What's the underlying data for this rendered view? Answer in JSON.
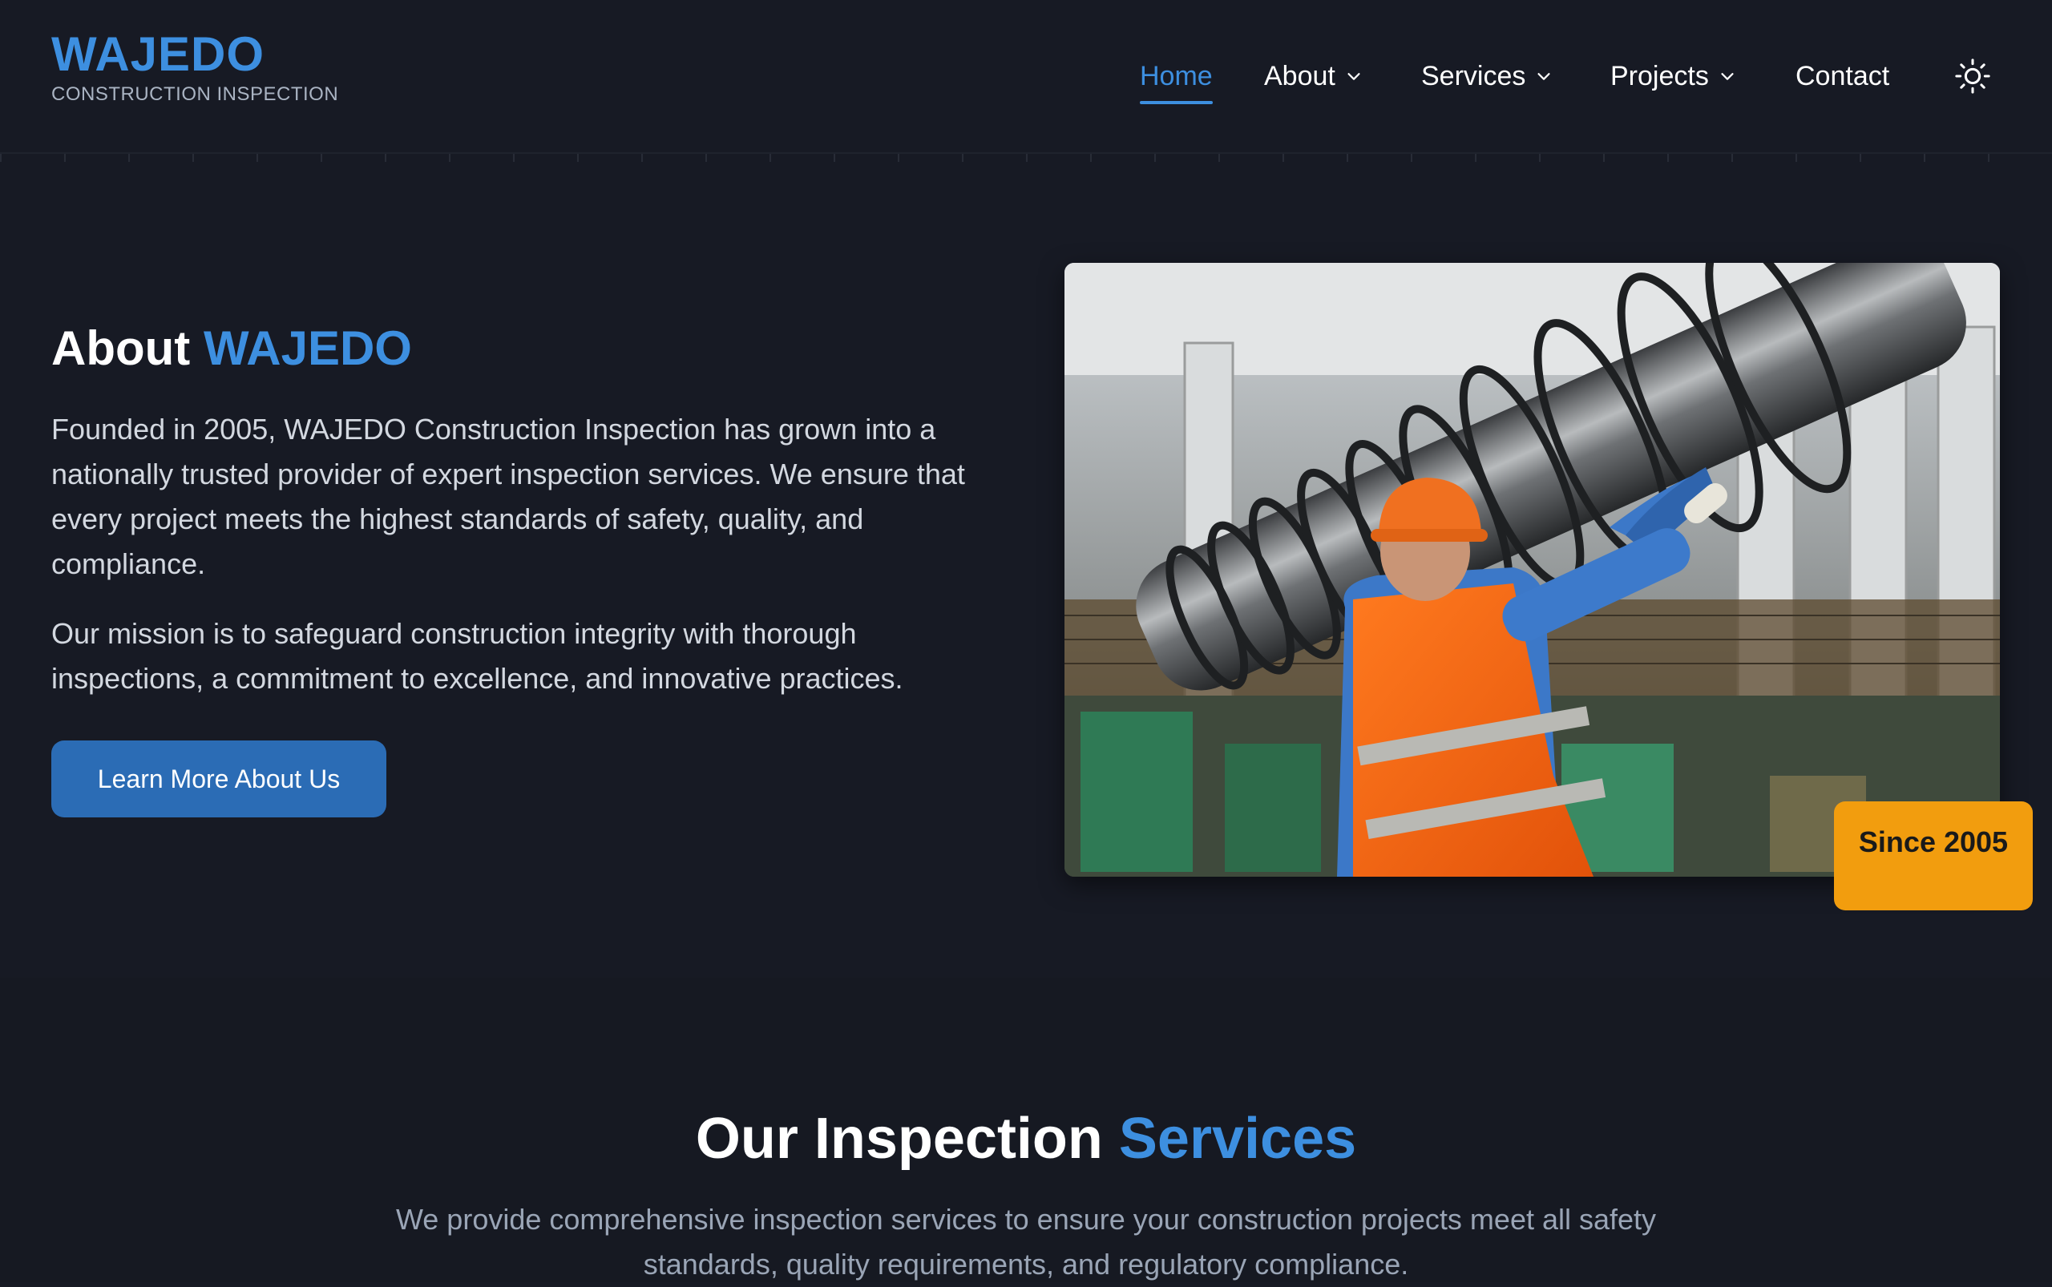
{
  "header": {
    "logo_title": "WAJEDO",
    "logo_subtitle": "CONSTRUCTION INSPECTION",
    "nav": [
      {
        "label": "Home",
        "active": true,
        "dropdown": false
      },
      {
        "label": "About",
        "active": false,
        "dropdown": true
      },
      {
        "label": "Services",
        "active": false,
        "dropdown": true
      },
      {
        "label": "Projects",
        "active": false,
        "dropdown": true
      },
      {
        "label": "Contact",
        "active": false,
        "dropdown": false
      }
    ],
    "theme_toggle_icon": "sun-icon"
  },
  "about": {
    "heading_prefix": "About ",
    "heading_accent": "WAJEDO",
    "paragraph1": "Founded in 2005, WAJEDO Construction Inspection has grown into a nationally trusted provider of expert inspection services. We ensure that every project meets the highest standards of safety, quality, and compliance.",
    "paragraph2": "Our mission is to safeguard construction integrity with thorough inspections, a commitment to excellence, and innovative practices.",
    "cta_label": "Learn More About Us",
    "badge": "Since 2005"
  },
  "services": {
    "heading_prefix": "Our Inspection ",
    "heading_accent": "Services",
    "subtitle": "We provide comprehensive inspection services to ensure your construction projects meet all safety standards, quality requirements, and regulatory compliance."
  },
  "colors": {
    "background": "#171a24",
    "accent": "#3d8fe0",
    "button": "#2b6cb5",
    "badge": "#f29d0e"
  }
}
